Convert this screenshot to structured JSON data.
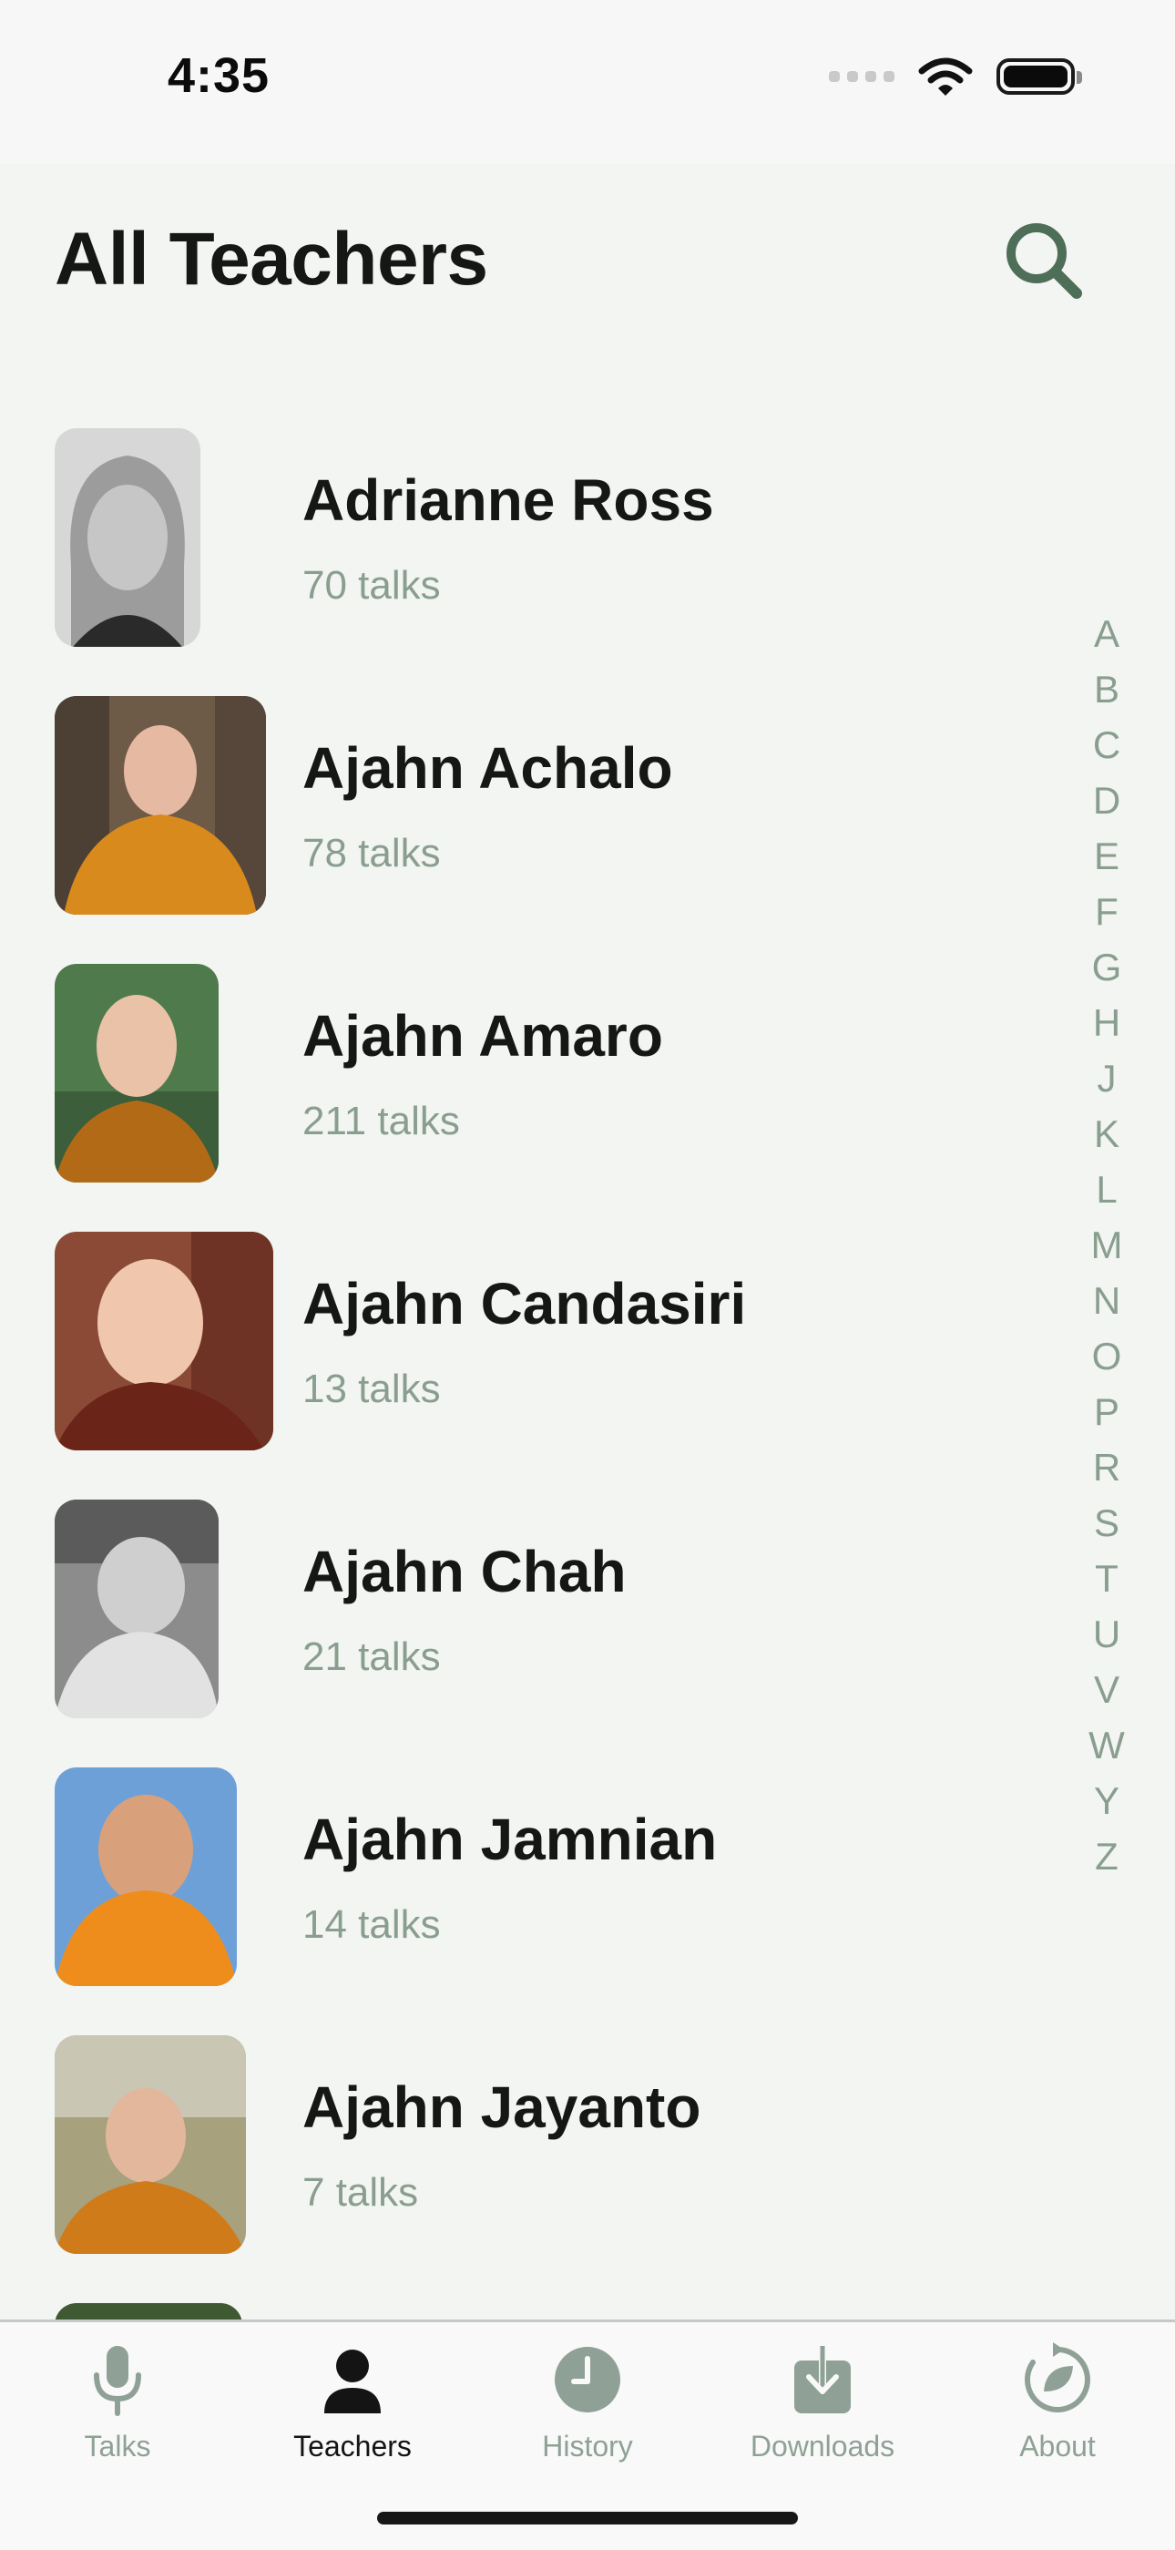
{
  "status_bar": {
    "time": "4:35"
  },
  "header": {
    "title": "All Teachers",
    "search_icon": "search-icon"
  },
  "teachers": [
    {
      "name": "Adrianne Ross",
      "talks": "70 talks"
    },
    {
      "name": "Ajahn Achalo",
      "talks": "78 talks"
    },
    {
      "name": "Ajahn Amaro",
      "talks": "211 talks"
    },
    {
      "name": "Ajahn Candasiri",
      "talks": "13 talks"
    },
    {
      "name": "Ajahn Chah",
      "talks": "21 talks"
    },
    {
      "name": "Ajahn Jamnian",
      "talks": "14 talks"
    },
    {
      "name": "Ajahn Jayanto",
      "talks": "7 talks"
    }
  ],
  "alphabet_index": [
    "A",
    "B",
    "C",
    "D",
    "E",
    "F",
    "G",
    "H",
    "J",
    "K",
    "L",
    "M",
    "N",
    "O",
    "P",
    "R",
    "S",
    "T",
    "U",
    "V",
    "W",
    "Y",
    "Z"
  ],
  "tab_bar": {
    "tabs": [
      {
        "label": "Talks",
        "icon": "microphone-icon",
        "active": false
      },
      {
        "label": "Teachers",
        "icon": "person-icon",
        "active": true
      },
      {
        "label": "History",
        "icon": "clock-icon",
        "active": false
      },
      {
        "label": "Downloads",
        "icon": "download-icon",
        "active": false
      },
      {
        "label": "About",
        "icon": "about-icon",
        "active": false
      }
    ]
  },
  "colors": {
    "background": "#f2f5f2",
    "accent": "#4e6e58",
    "muted_text": "#8a9e8f",
    "inactive_tab": "#8fa196",
    "active_tab": "#141414"
  }
}
